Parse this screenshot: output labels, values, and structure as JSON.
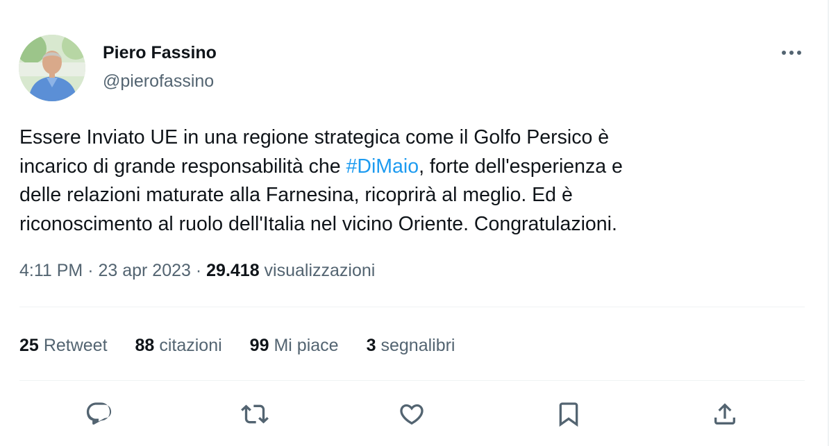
{
  "author": {
    "name": "Piero Fassino",
    "handle": "@pierofassino"
  },
  "tweet": {
    "line1": "Essere Inviato UE in una regione strategica come il Golfo Persico è",
    "line2_before": "incarico di grande responsabilità che ",
    "hashtag": "#DiMaio",
    "line2_after": ", forte dell'esperienza e",
    "line3": "delle relazioni maturate alla Farnesina, ricoprirà al meglio. Ed è",
    "line4": "riconoscimento al ruolo dell'Italia nel vicino Oriente. Congratulazioni."
  },
  "meta": {
    "time": "4:11 PM",
    "separator": " · ",
    "date": "23 apr 2023",
    "views_count": "29.418",
    "views_label": " visualizzazioni"
  },
  "stats": {
    "retweets_count": "25",
    "retweets_label": "Retweet",
    "quotes_count": "88",
    "quotes_label": "citazioni",
    "likes_count": "99",
    "likes_label": "Mi piace",
    "bookmarks_count": "3",
    "bookmarks_label": "segnalibri"
  },
  "actions": [
    "reply-icon",
    "retweet-icon",
    "like-icon",
    "bookmark-icon",
    "share-icon"
  ],
  "colors": {
    "text": "#0f1419",
    "secondary": "#536471",
    "link": "#1d9bf0",
    "divider": "#eff3f4"
  }
}
